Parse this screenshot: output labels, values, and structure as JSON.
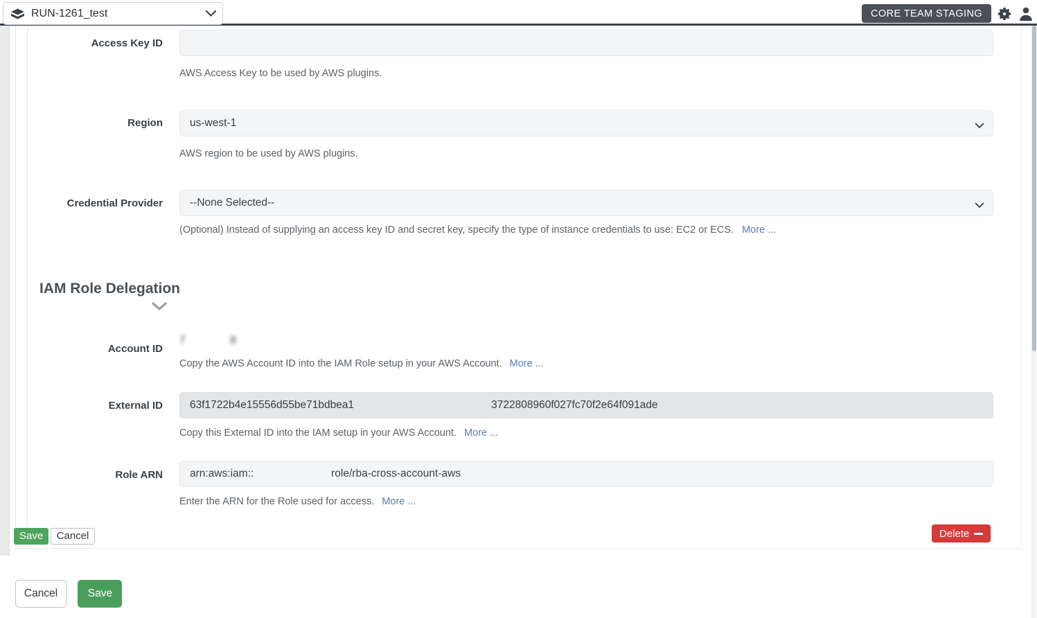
{
  "topbar": {
    "project_name": "RUN-1261_test",
    "project_icon": "package-icon",
    "chevron_icon": "chevron-down-icon",
    "env_badge": "CORE TEAM STAGING",
    "gear_icon": "gear-icon",
    "user_icon": "user-icon",
    "badge_bg": "#4b5058"
  },
  "form": {
    "access_key": {
      "label": "Access Key ID",
      "value": "",
      "help": "AWS Access Key to be used by AWS plugins."
    },
    "region": {
      "label": "Region",
      "value": "us-west-1",
      "help": "AWS region to be used by AWS plugins.",
      "chevron_icon": "chevron-down-icon"
    },
    "credential_provider": {
      "label": "Credential Provider",
      "value": "--None Selected--",
      "help": "(Optional) Instead of supplying an access key ID and secret key, specify the type of instance credentials to use: EC2 or ECS.",
      "more_label": "More ...",
      "chevron_icon": "chevron-down-icon"
    }
  },
  "iam_section": {
    "title": "IAM Role Delegation",
    "collapse_icon": "chevron-down-icon",
    "account_id": {
      "label": "Account ID",
      "value_prefix": "7",
      "value_suffix": "8",
      "help": "Copy the AWS Account ID into the IAM Role setup in your AWS Account.",
      "more_label": "More ..."
    },
    "external_id": {
      "label": "External ID",
      "value_part1": "63f1722b4e15556d55be71bdbea1",
      "value_part2": "3722808960f027fc70f2e64f091ade",
      "help": "Copy this External ID into the IAM setup in your AWS Account.",
      "more_label": "More ..."
    },
    "role_arn": {
      "label": "Role ARN",
      "value_prefix": "arn:aws:iam::",
      "value_suffix": "role/rba-cross-account-aws",
      "help": "Enter the ARN for the Role used for access.",
      "more_label": "More ..."
    }
  },
  "inline_actions": {
    "save_label": "Save",
    "cancel_label": "Cancel",
    "delete_label": "Delete",
    "delete_icon": "minus-icon",
    "save_bg": "#4da45d",
    "delete_bg": "#d63b3b"
  },
  "bottom_actions": {
    "cancel_label": "Cancel",
    "save_label": "Save",
    "save_bg": "#4a9e5c"
  }
}
